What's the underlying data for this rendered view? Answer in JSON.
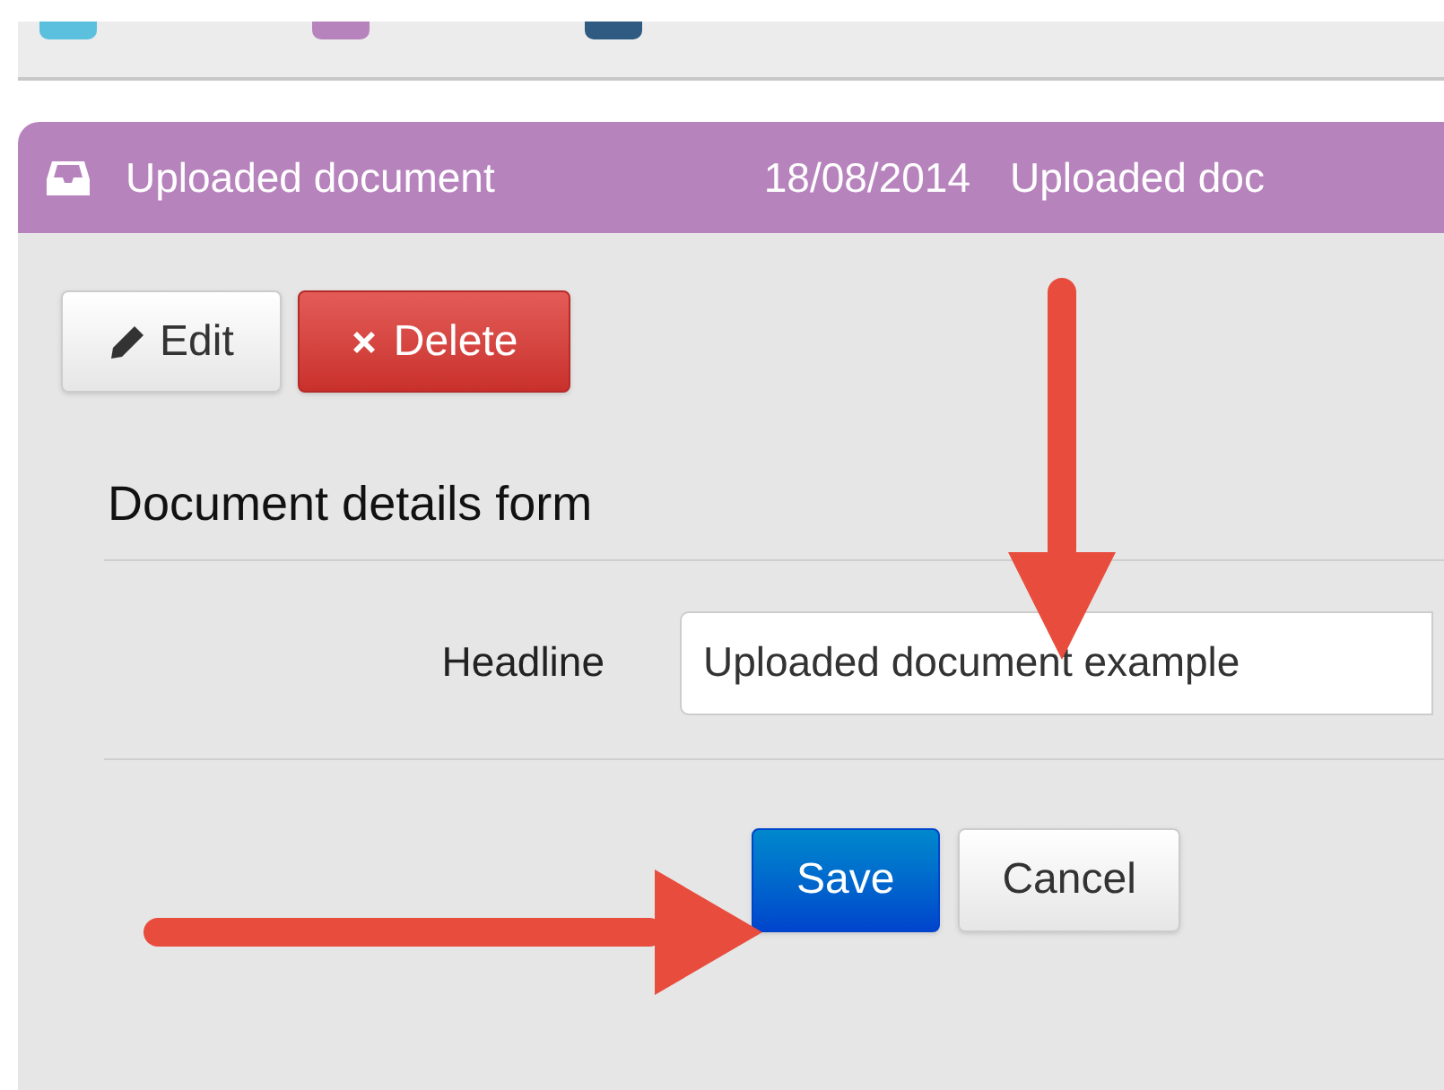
{
  "toolbar": {
    "items": [
      {
        "color": "#5bc0de"
      },
      {
        "color": "#b783bd"
      },
      {
        "color": "#2f5a82"
      }
    ]
  },
  "panel": {
    "title": "Uploaded document",
    "date": "18/08/2014",
    "summary": "Uploaded doc"
  },
  "actions": [
    {
      "label": "Edit",
      "kind": "default"
    },
    {
      "label": "Delete",
      "kind": "danger"
    }
  ],
  "form": {
    "title": "Document details form",
    "fields": [
      {
        "label": "Headline",
        "value": "Uploaded document example"
      }
    ],
    "buttons": [
      {
        "label": "Save",
        "kind": "primary"
      },
      {
        "label": "Cancel",
        "kind": "default"
      }
    ]
  }
}
